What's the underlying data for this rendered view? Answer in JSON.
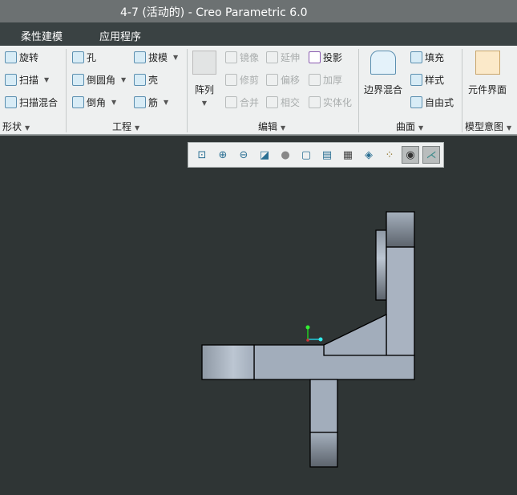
{
  "window": {
    "title": "4-7 (活动的) - Creo Parametric 6.0"
  },
  "menu": [
    "柔性建模",
    "应用程序"
  ],
  "ribbon": {
    "shape": {
      "label": "形状",
      "items": [
        "旋转",
        "扫描",
        "扫描混合"
      ]
    },
    "engineering": {
      "label": "工程",
      "items": [
        "孔",
        "倒圆角",
        "倒角",
        "拔模",
        "壳",
        "筋"
      ]
    },
    "edit": {
      "label": "编辑",
      "pattern": "阵列",
      "items": [
        "镜像",
        "修剪",
        "合并",
        "延伸",
        "偏移",
        "相交",
        "投影",
        "加厚",
        "实体化"
      ]
    },
    "surface": {
      "label": "曲面",
      "boundary": "边界混合",
      "items": [
        "填充",
        "样式",
        "自由式"
      ]
    },
    "model_intent": {
      "label": "模型意图",
      "component_interface": "元件界面"
    }
  },
  "view_toolbar": {
    "icons": [
      "refit-icon",
      "zoom-in-icon",
      "zoom-out-icon",
      "repaint-icon",
      "display-style-icon",
      "saved-orientations-icon",
      "view-manager-icon",
      "perspective-icon",
      "section-icon",
      "datum-display-icon",
      "annotation-display-icon",
      "spin-center-icon"
    ],
    "active": [
      "annotation-display-icon",
      "spin-center-icon"
    ]
  },
  "colors": {
    "model": "#a2adbb",
    "background": "#2f3535"
  }
}
